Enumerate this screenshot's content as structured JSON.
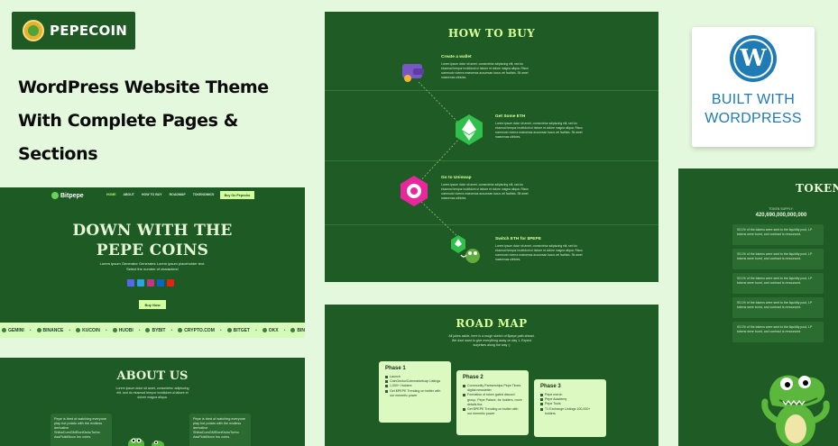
{
  "brand": {
    "name": "PEPECOIN"
  },
  "headline": {
    "line1": "WordPress Website Theme",
    "line2": "With Complete Pages &",
    "line3": "Sections"
  },
  "hero": {
    "logo": "Bitpepe",
    "menu": [
      "HOME",
      "ABOUT",
      "HOW TO BUY",
      "ROADMAP",
      "TOKENOMICS",
      "ROADMAP"
    ],
    "buy_button": "Buy On Pepecho",
    "title_line1": "DOWN WITH THE",
    "title_line2": "PEPE COINS",
    "description": "Lorem ipsum Generator Generates Lorem ipsum placeholder text. Select the number of characters!",
    "cta": "Buy Now"
  },
  "ticker": [
    "GEMINI",
    "BINANCE",
    "KUCOIN",
    "HUOBI",
    "BYBIT",
    "CRYPTO.COM",
    "BITGET",
    "OKX",
    "BINGX JAPAN"
  ],
  "about": {
    "title": "ABOUT US",
    "description": "Lorem ipsum dolor sit amet, consectetur adipiscing elit, sed do eiusmod tempor incididunt ut labore et dolore magna aliqua.",
    "card1": "Pepe is tired of watching everyone play hot potato with the endless derivative ShibaCumGMElonKishuTurbo AssFlokiMoon Inu coins.",
    "card2": "Pepe is tired of watching everyone play hot potato with the endless derivative ShibaCumGMElonKishuTurbo AssFlokiMoon Inu coins."
  },
  "how_to_buy": {
    "title": "HOW TO BUY",
    "steps": [
      {
        "title": "Create a wallet",
        "text": "Lorem ipsum dolor sit amet, consectetur adipiscing elit, sed do eiusmod tempor incididunt ut labore et dolore magna aliqua. Risus commodo viverra maecenas accumsan lacus vel facilisis. Sit amet maecenas ultricies."
      },
      {
        "title": "Get Some ETH",
        "text": "Lorem ipsum dolor sit amet, consectetur adipiscing elit, sed do eiusmod tempor incididunt ut labore et dolore magna aliqua. Risus commodo viverra maecenas accumsan lacus vel facilisis. Sit amet maecenas ultricies."
      },
      {
        "title": "Go to Uniswap",
        "text": "Lorem ipsum dolor sit amet, consectetur adipiscing elit, sed do eiusmod tempor incididunt ut labore et dolore magna aliqua. Risus commodo viverra maecenas accumsan lacus vel facilisis. Sit amet maecenas ultricies."
      },
      {
        "title": "Switch ETH for $PEPE",
        "text": "Lorem ipsum dolor sit amet, consectetur adipiscing elit, sed do eiusmod tempor incididunt ut labore et dolore magna aliqua. Risus commodo viverra maecenas accumsan lacus vel facilisis. Sit amet maecenas ultricies."
      }
    ]
  },
  "road_map": {
    "title": "ROAD MAP",
    "description": "All jokes aside, here is a rough sketch of $pepe path ahead. We dont want to give everything away on day 1. Expect surprises along the way :)",
    "phases": [
      {
        "title": "Phase 1",
        "items": [
          "Launch",
          "CoinGecko/Coinmarketcap Listings",
          "1,000+ Holders",
          "Get $PEPE Trending on twitter with our memetic power"
        ]
      },
      {
        "title": "Phase 2",
        "items": [
          "Community Partnerships Pepe Times digital newsletter",
          "Formation of token gated discord group, Pepe Palace, for holders, more details tba",
          "Get $PEPE Trending on twitter with our memetic power"
        ]
      },
      {
        "title": "Phase 3",
        "items": [
          "Pepe merch",
          "Pepe Academy",
          "Pepe Tools",
          "T1 Exchange Listings 100,000+ holders"
        ]
      }
    ]
  },
  "wordpress": {
    "line1": "BUILT WITH",
    "line2": "WORDPRESS",
    "glyph": "W"
  },
  "tokenomics": {
    "title": "TOKEN",
    "supply_label": "TOKEN SUPPLY:",
    "supply_value": "420,690,000,000,000",
    "rows": [
      "93.1% of the tokens were sent to the liquidity pool, LP tokens were burnt, and contract is renounced.",
      "93.1% of the tokens were sent to the liquidity pool, LP tokens were burnt, and contract is renounced.",
      "93.1% of the tokens were sent to the liquidity pool, LP tokens were burnt, and contract is renounced.",
      "93.1% of the tokens were sent to the liquidity pool, LP tokens were burnt, and contract is renounced.",
      "93.1% of the tokens were sent to the liquidity pool, LP tokens were burnt, and contract is renounced."
    ]
  },
  "colors": {
    "page_bg": "#e4f8de",
    "panel_green": "#1f5b24",
    "accent_lime": "#d8ff9c",
    "wordpress_blue": "#1e7bb5"
  },
  "icons": {
    "wallet": "wallet-icon",
    "eth": "ethereum-icon",
    "uniswap": "uniswap-icon",
    "switch": "pepe-swap-icon",
    "wordpress": "wordpress-logo-icon",
    "mascot": "crocodile-mascot-icon"
  }
}
